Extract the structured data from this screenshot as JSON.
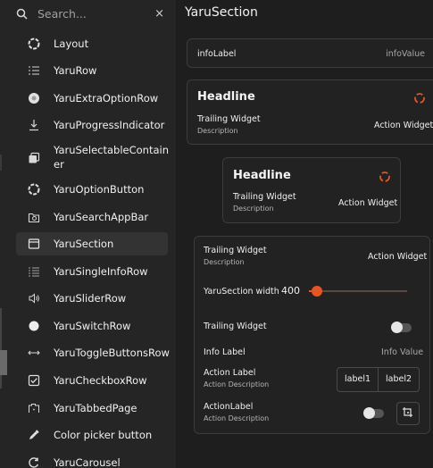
{
  "search": {
    "placeholder": "Search...",
    "clear_symbol": "×"
  },
  "sidebar": {
    "items": [
      {
        "label": "Layout",
        "icon": "layout-icon"
      },
      {
        "label": "YaruRow",
        "icon": "row-list-icon"
      },
      {
        "label": "YaruExtraOptionRow",
        "icon": "extra-option-icon"
      },
      {
        "label": "YaruProgressIndicator",
        "icon": "progress-indicator-icon"
      },
      {
        "label": "YaruSelectableContain",
        "label2": "er",
        "icon": "selectable-container-icon"
      },
      {
        "label": "YaruOptionButton",
        "icon": "option-button-icon"
      },
      {
        "label": "YaruSearchAppBar",
        "icon": "search-appbar-icon"
      },
      {
        "label": "YaruSection",
        "icon": "section-icon"
      },
      {
        "label": "YaruSingleInfoRow",
        "icon": "single-info-row-icon"
      },
      {
        "label": "YaruSliderRow",
        "icon": "speaker-icon"
      },
      {
        "label": "YaruSwitchRow",
        "icon": "switch-dot-icon"
      },
      {
        "label": "YaruToggleButtonsRow",
        "icon": "toggle-buttons-icon"
      },
      {
        "label": "YaruCheckboxRow",
        "icon": "checkbox-icon"
      },
      {
        "label": "YaruTabbedPage",
        "icon": "tabbed-page-icon"
      },
      {
        "label": "Color picker button",
        "icon": "color-picker-icon"
      },
      {
        "label": "YaruCarousel",
        "icon": "carousel-icon"
      }
    ],
    "active_index": 7
  },
  "header": {
    "title": "YaruSection"
  },
  "info_row": {
    "label": "infoLabel",
    "value": "infoValue"
  },
  "section1": {
    "headline": "Headline",
    "trailing": "Trailing Widget",
    "description": "Description",
    "action": "Action Widget"
  },
  "section2": {
    "headline": "Headline",
    "trailing": "Trailing Widget",
    "description": "Description",
    "action": "Action Widget"
  },
  "section3": {
    "row1": {
      "trailing": "Trailing Widget",
      "description": "Description",
      "action": "Action Widget"
    },
    "slider": {
      "label": "YaruSection width",
      "value": "400",
      "fraction": 0.08
    },
    "switch_row": {
      "label": "Trailing Widget",
      "on": false
    },
    "info": {
      "label": "Info Label",
      "value": "Info Value"
    },
    "action_row": {
      "label": "Action Label",
      "description": "Action Description",
      "buttons": [
        "label1",
        "label2"
      ]
    },
    "action_row2": {
      "label": "ActionLabel",
      "description": "Action Description",
      "on": false
    }
  },
  "colors": {
    "accent": "#e95420",
    "background": "#1e1e1e",
    "sidebar": "#252525"
  }
}
